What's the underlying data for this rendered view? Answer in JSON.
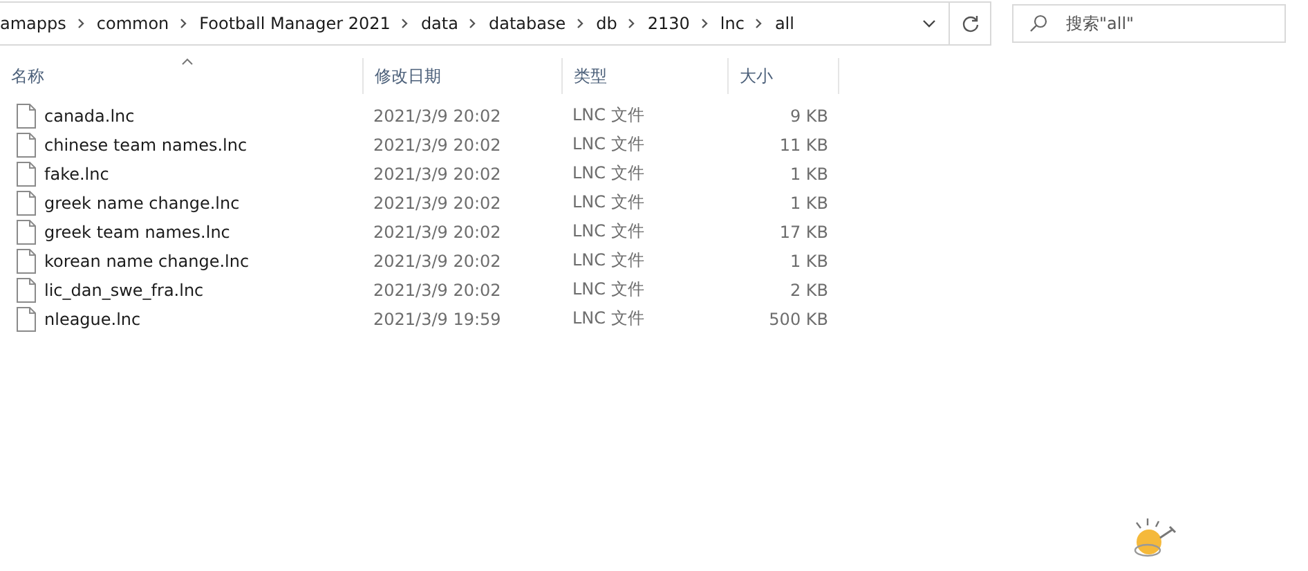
{
  "address_bar": {
    "crumbs": [
      "amapps",
      "common",
      "Football Manager 2021",
      "data",
      "database",
      "db",
      "2130",
      "lnc",
      "all"
    ]
  },
  "search": {
    "placeholder": "搜索\"all\""
  },
  "columns": [
    {
      "label": "名称",
      "sorted": true
    },
    {
      "label": "修改日期",
      "sorted": false
    },
    {
      "label": "类型",
      "sorted": false
    },
    {
      "label": "大小",
      "sorted": false
    }
  ],
  "files": [
    {
      "name": "canada.lnc",
      "modified": "2021/3/9 20:02",
      "type": "LNC 文件",
      "size": "9 KB"
    },
    {
      "name": "chinese team names.lnc",
      "modified": "2021/3/9 20:02",
      "type": "LNC 文件",
      "size": "11 KB"
    },
    {
      "name": "fake.lnc",
      "modified": "2021/3/9 20:02",
      "type": "LNC 文件",
      "size": "1 KB"
    },
    {
      "name": "greek name change.lnc",
      "modified": "2021/3/9 20:02",
      "type": "LNC 文件",
      "size": "1 KB"
    },
    {
      "name": "greek team names.lnc",
      "modified": "2021/3/9 20:02",
      "type": "LNC 文件",
      "size": "17 KB"
    },
    {
      "name": "korean name change.lnc",
      "modified": "2021/3/9 20:02",
      "type": "LNC 文件",
      "size": "1 KB"
    },
    {
      "name": "lic_dan_swe_fra.lnc",
      "modified": "2021/3/9 20:02",
      "type": "LNC 文件",
      "size": "2 KB"
    },
    {
      "name": "nleague.lnc",
      "modified": "2021/3/9 19:59",
      "type": "LNC 文件",
      "size": "500 KB"
    }
  ]
}
